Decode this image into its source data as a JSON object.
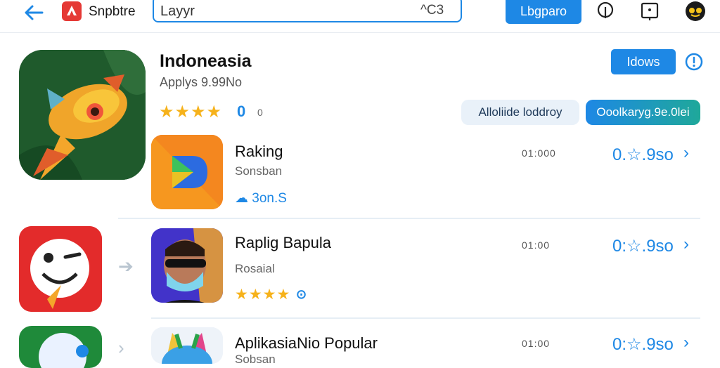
{
  "topbar": {
    "brand": "Snpbtre",
    "search_value": "Layyr",
    "search_shortcut": "^C3",
    "update_label": "Lbgparo"
  },
  "featured": {
    "title": "Indoneasia",
    "subtitle": "Applys 9.99No",
    "stars": "★★★★",
    "badge": "0",
    "rating_count": "0",
    "view_label": "Idows",
    "chip_left": "Alloliide loddroy",
    "chip_right": "Ooolkaryg.9e.0lei"
  },
  "rows": [
    {
      "title": "Raking",
      "subtitle": "Sonsban",
      "meta": "01:000",
      "price": "0.☆.9so",
      "link_label": "☁ 3on.S"
    },
    {
      "title": "Raplig Bapula",
      "subtitle": "Rosaial",
      "meta": "01:00",
      "price": "0:☆.9so",
      "stars": "★★★★"
    },
    {
      "title": "AplikasiaNio Popular",
      "subtitle": "Sobsan",
      "meta": "01:00",
      "price": "0:☆.9so"
    }
  ],
  "icons": [
    "back-arrow-icon",
    "store-logo-icon",
    "lightbulb-icon",
    "download-icon",
    "avatar-icon",
    "info-icon",
    "arrow-right-icon"
  ],
  "colors": {
    "accent": "#1e88e5",
    "star": "#f6b21b",
    "logo": "#e53935"
  }
}
